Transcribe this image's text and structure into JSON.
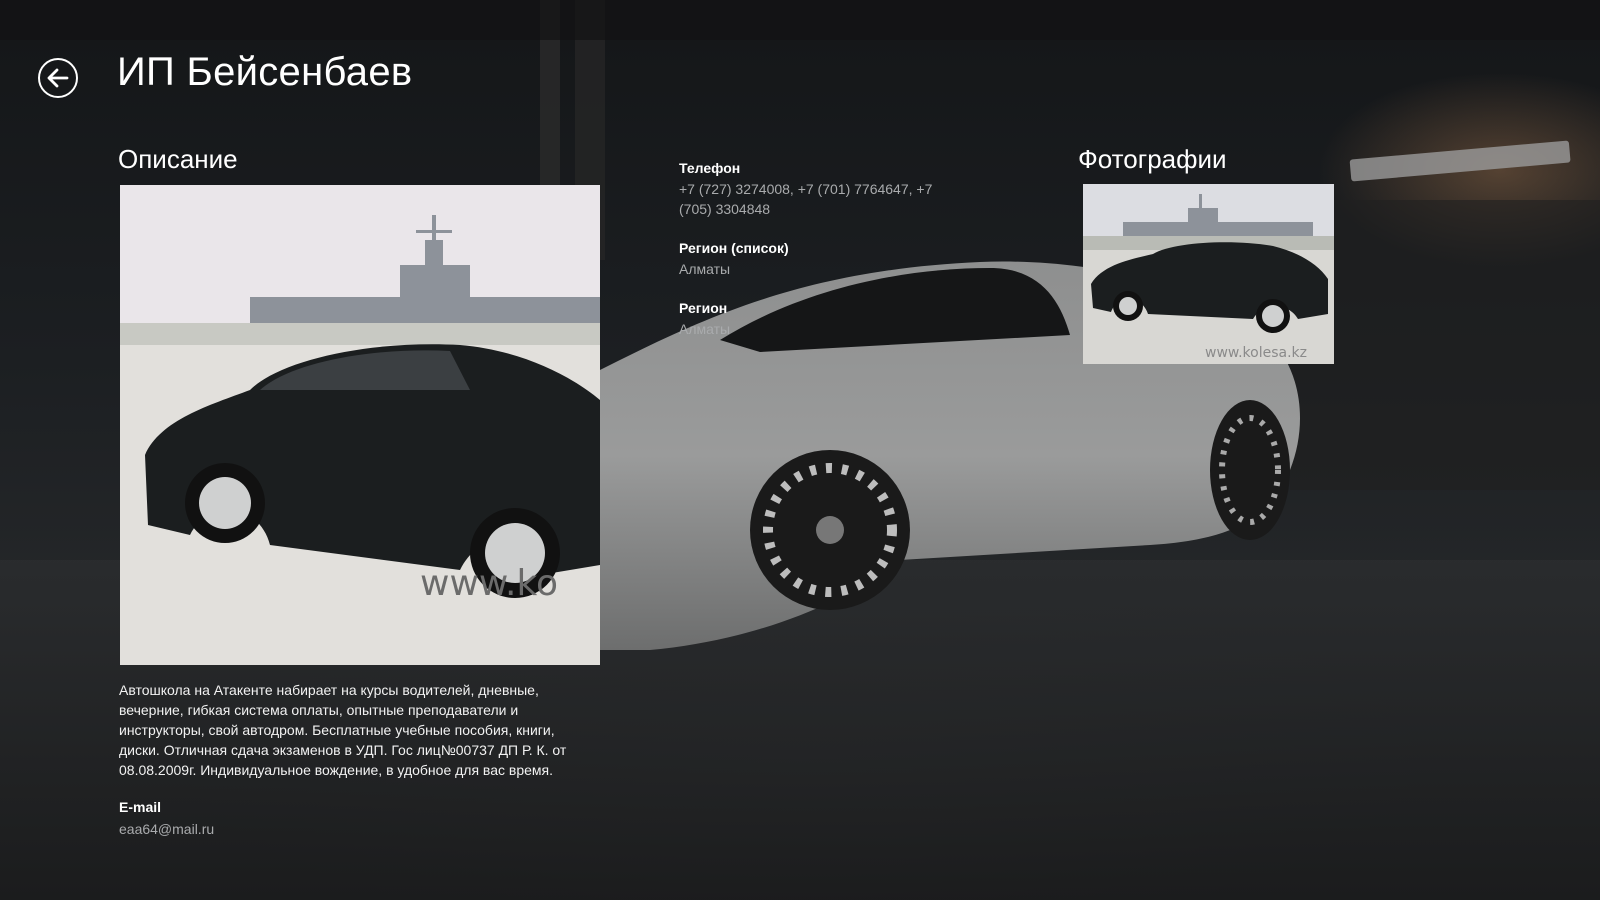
{
  "header": {
    "title": "ИП Бейсенбаев",
    "back_icon": "back-arrow-icon"
  },
  "description_section": {
    "title": "Описание",
    "text": "Автошкола на Атакенте набирает на курсы водителей, дневные, вечерние, гибкая система оплаты, опытные преподаватели и инструкторы, свой автодром. Бесплатные учебные пособия, книги, диски. Отличная сдача экзаменов в УДП. Гос лиц№00737 ДП Р. К. от 08.08.2009г. Индивидуальное вождение, в удобное для вас время.",
    "photo_watermark": "www.ko"
  },
  "contacts": {
    "email_label": "E-mail",
    "email_value": "eaa64@mail.ru",
    "phone_label": "Телефон",
    "phone_value": "+7 (727) 3274008, +7 (701) 7764647, +7 (705) 3304848",
    "region_list_label": "Регион (список)",
    "region_list_value": "Алматы",
    "region_label": "Регион",
    "region_value": "Алматы"
  },
  "photos_section": {
    "title": "Фотографии",
    "thumb_watermark": "www.kolesa.kz"
  },
  "colors": {
    "background": "#1c1f22",
    "text": "#ffffff",
    "secondary_text": "#a9abad"
  }
}
